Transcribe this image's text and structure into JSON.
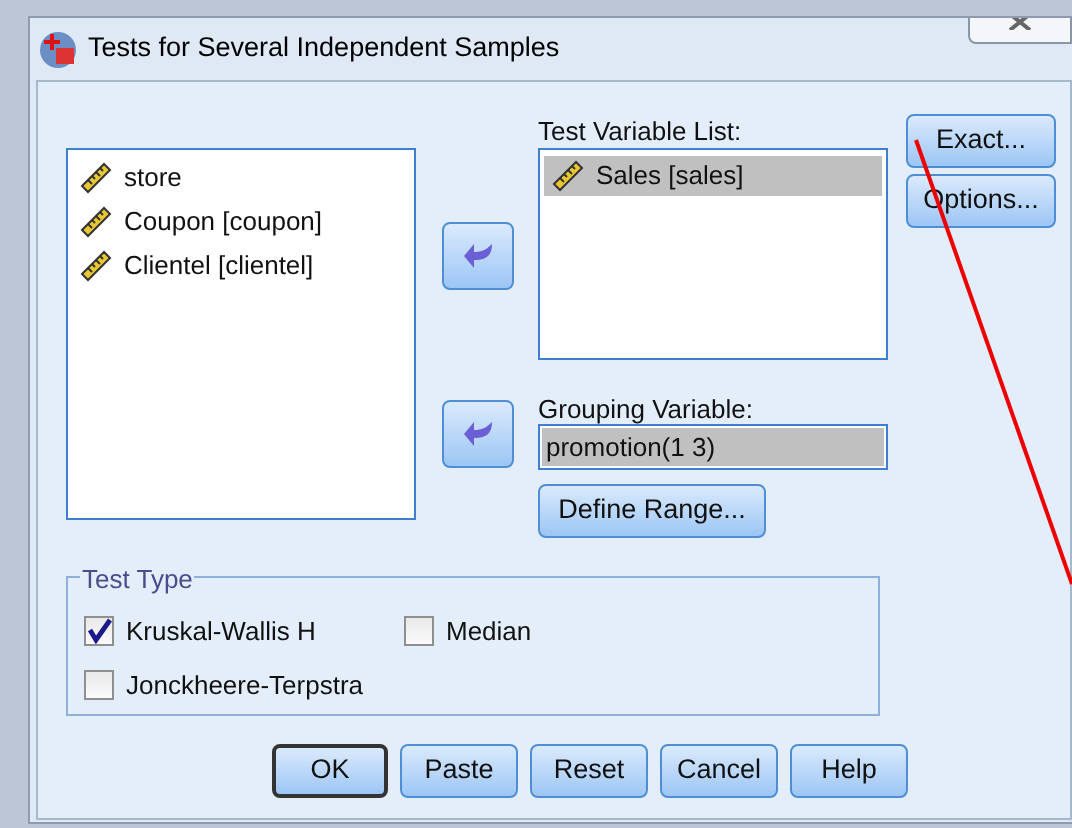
{
  "window": {
    "title": "Tests for Several Independent Samples"
  },
  "source_list": {
    "items": [
      {
        "label": "store",
        "selected": false
      },
      {
        "label": "Coupon [coupon]",
        "selected": false
      },
      {
        "label": "Clientel [clientel]",
        "selected": false
      }
    ]
  },
  "test_variable_list": {
    "label": "Test Variable List:",
    "items": [
      {
        "label": "Sales [sales]",
        "selected": true
      }
    ]
  },
  "grouping_variable": {
    "label": "Grouping Variable:",
    "value": "promotion(1 3)"
  },
  "define_range_button": "Define Range...",
  "side_buttons": [
    "Exact...",
    "Options..."
  ],
  "test_type": {
    "title": "Test Type",
    "options": [
      {
        "label": "Kruskal-Wallis H",
        "checked": true
      },
      {
        "label": "Median",
        "checked": false
      },
      {
        "label": "Jonckheere-Terpstra",
        "checked": false
      }
    ]
  },
  "buttons": [
    {
      "label": "OK",
      "default": true
    },
    {
      "label": "Paste",
      "default": false
    },
    {
      "label": "Reset",
      "default": false
    },
    {
      "label": "Cancel",
      "default": false
    },
    {
      "label": "Help",
      "default": false
    }
  ]
}
